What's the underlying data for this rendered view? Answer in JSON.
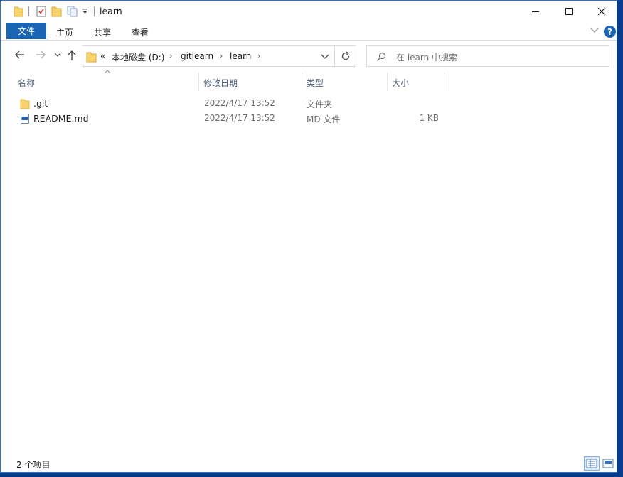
{
  "window": {
    "title": "learn"
  },
  "ribbon": {
    "tabs": [
      "文件",
      "主页",
      "共享",
      "查看"
    ],
    "help": "?"
  },
  "nav": {
    "overflow": "«",
    "breadcrumbs": [
      "本地磁盘 (D:)",
      "gitlearn",
      "learn"
    ],
    "search_placeholder": "在 learn 中搜索"
  },
  "columns": [
    "名称",
    "修改日期",
    "类型",
    "大小"
  ],
  "files": [
    {
      "name": ".git",
      "modified": "2022/4/17 13:52",
      "type": "文件夹",
      "size": "",
      "icon": "folder-icon"
    },
    {
      "name": "README.md",
      "modified": "2022/4/17 13:52",
      "type": "MD 文件",
      "size": "1 KB",
      "icon": "md-file-icon"
    }
  ],
  "status": {
    "item_count": "2 个项目"
  },
  "colors": {
    "accent": "#1a64b4",
    "folder": "#f8d26a",
    "desktop": "#0a3c8c"
  }
}
